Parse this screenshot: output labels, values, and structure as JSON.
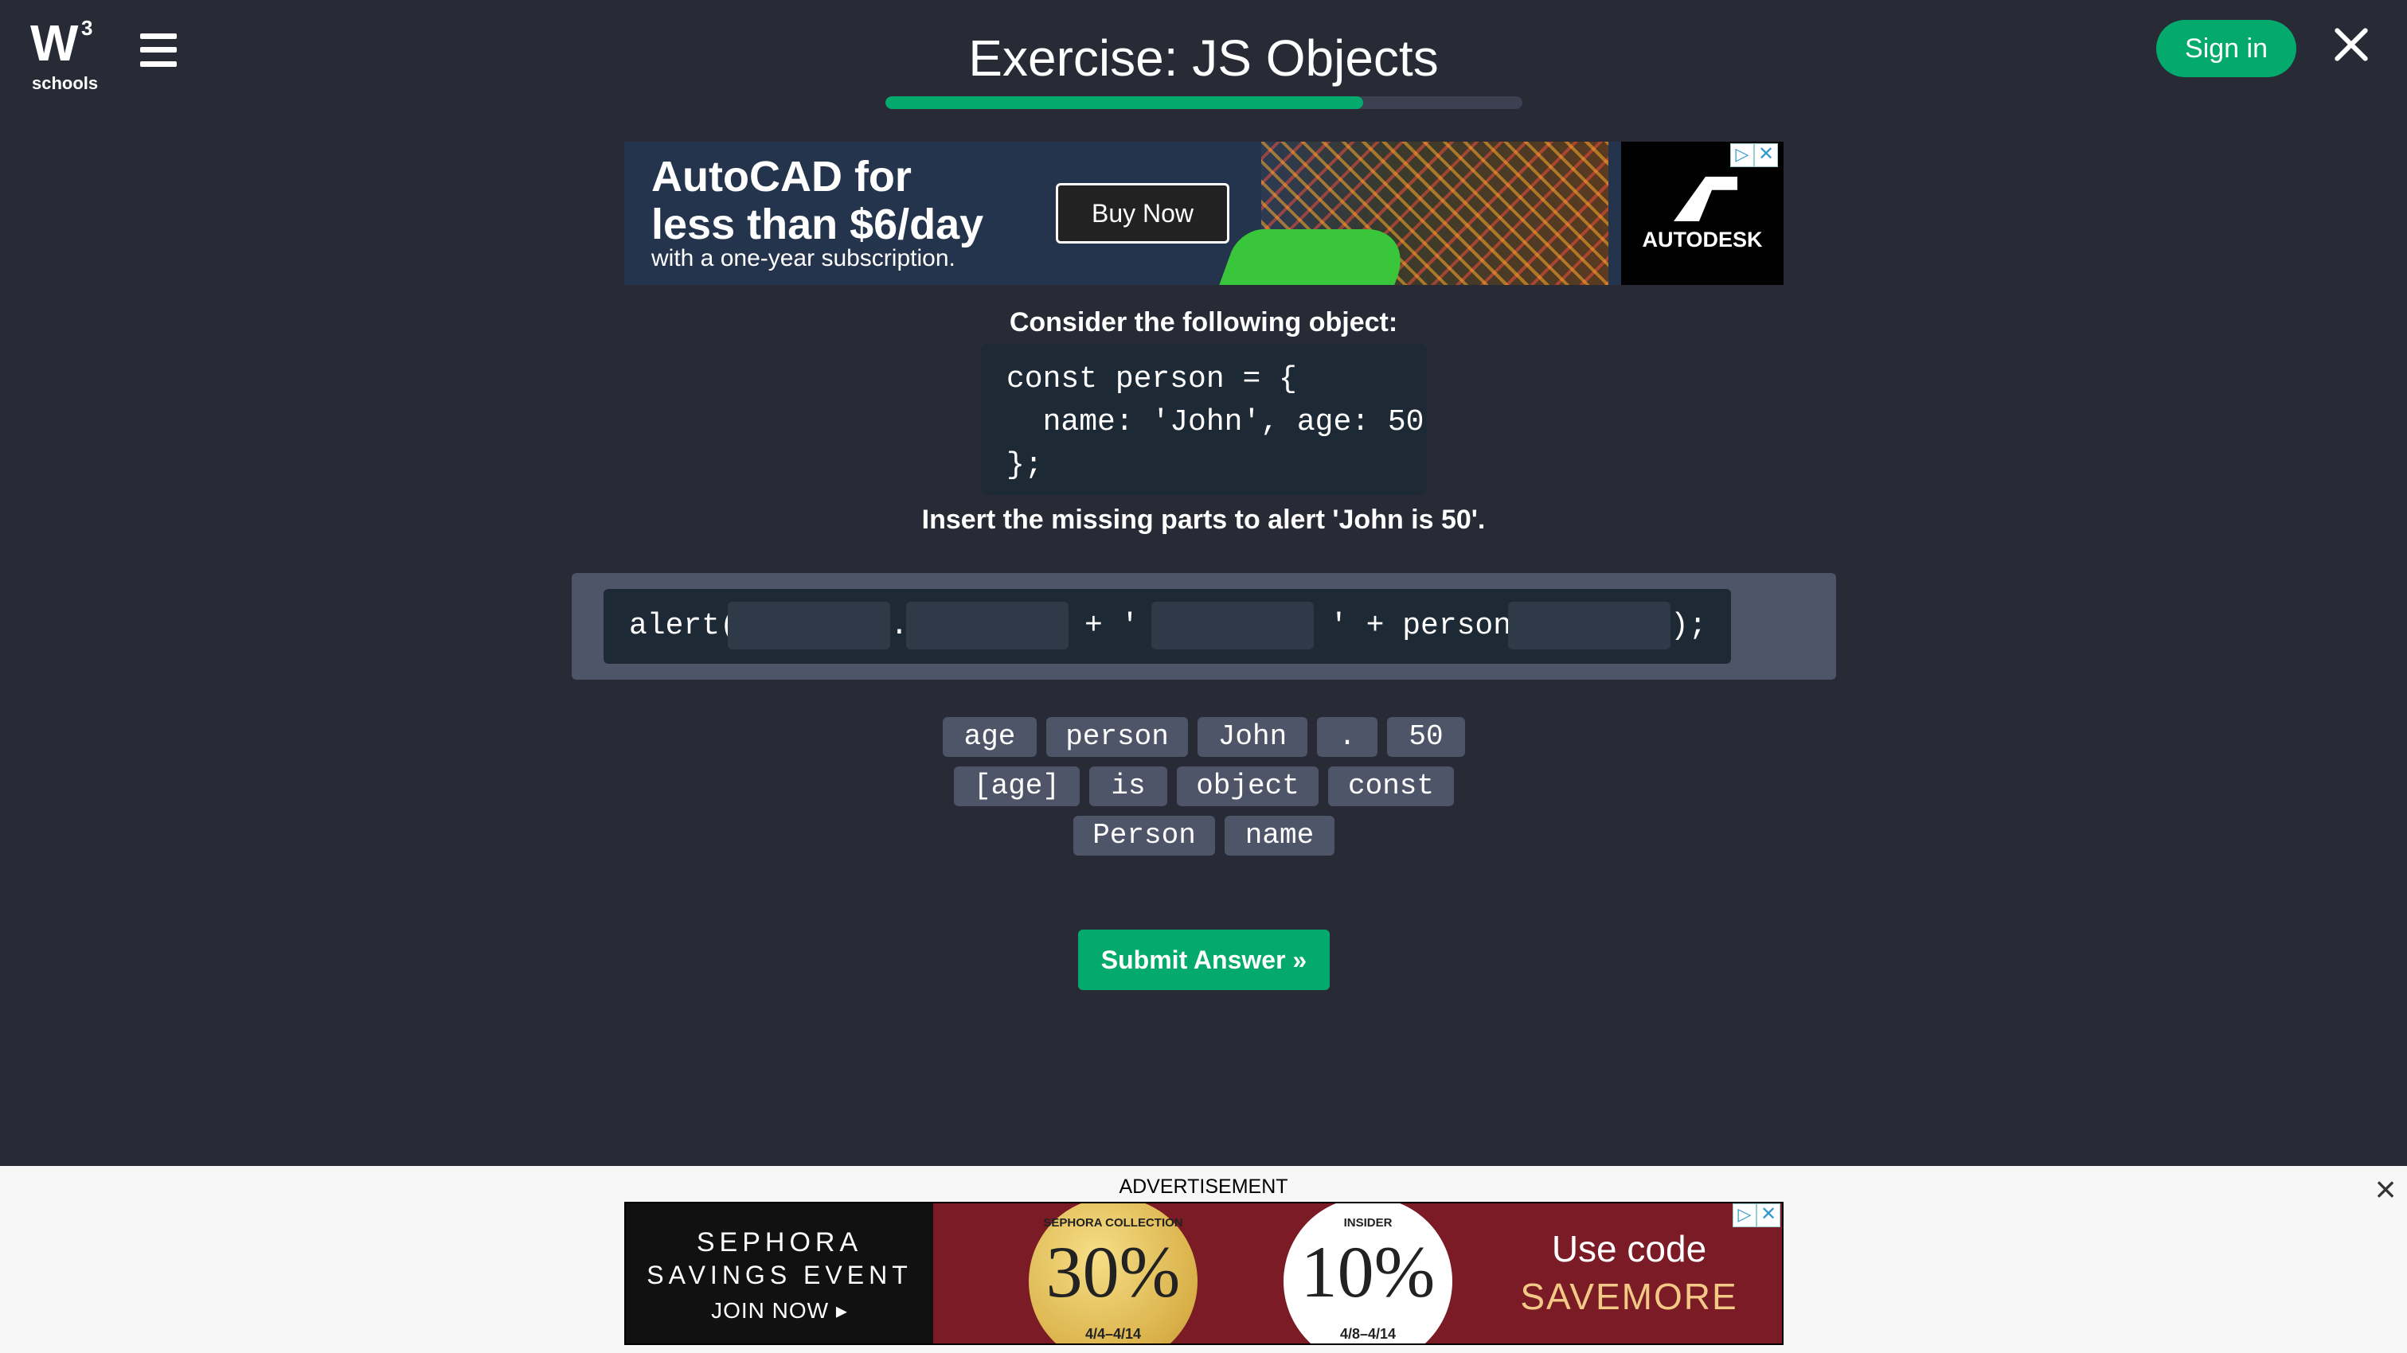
{
  "header": {
    "logo_mark": "W",
    "logo_sup": "3",
    "logo_word": "schools",
    "title": "Exercise: JS Objects",
    "progress": 0.75,
    "signin_label": "Sign in"
  },
  "top_ad": {
    "headline_line1": "AutoCAD for",
    "headline_line2": "less than $6/day",
    "subline": "with a one-year subscription.",
    "cta": "Buy Now",
    "brand": "AUTODESK"
  },
  "exercise": {
    "intro": "Consider the following object:",
    "code_lines": [
      "const person = {",
      "  name: 'John', age: 50",
      "};"
    ],
    "instruction": "Insert the missing parts to alert 'John is 50'.",
    "answer_tokens": {
      "t1": "alert(",
      "t2": ".",
      "t3": "+ '",
      "t4": "' + person.",
      "t5": ");"
    },
    "choices": [
      "age",
      "person",
      "John",
      ".",
      "50",
      "[age]",
      "is",
      "object",
      "const",
      "Person",
      "name"
    ],
    "submit_label": "Submit Answer »"
  },
  "bottom_ad": {
    "label": "ADVERTISEMENT",
    "brand_line1": "SEPHORA",
    "brand_line2": "SAVINGS EVENT",
    "brand_cta": "JOIN NOW ▸",
    "offer1_top": "SEPHORA COLLECTION",
    "offer1_value": "30%",
    "offer1_dates": "4/4–4/14",
    "offer2_top": "INSIDER",
    "offer2_value": "10%",
    "offer2_dates": "4/8–4/14",
    "code_line1": "Use code",
    "code_line2": "SAVEMORE"
  }
}
